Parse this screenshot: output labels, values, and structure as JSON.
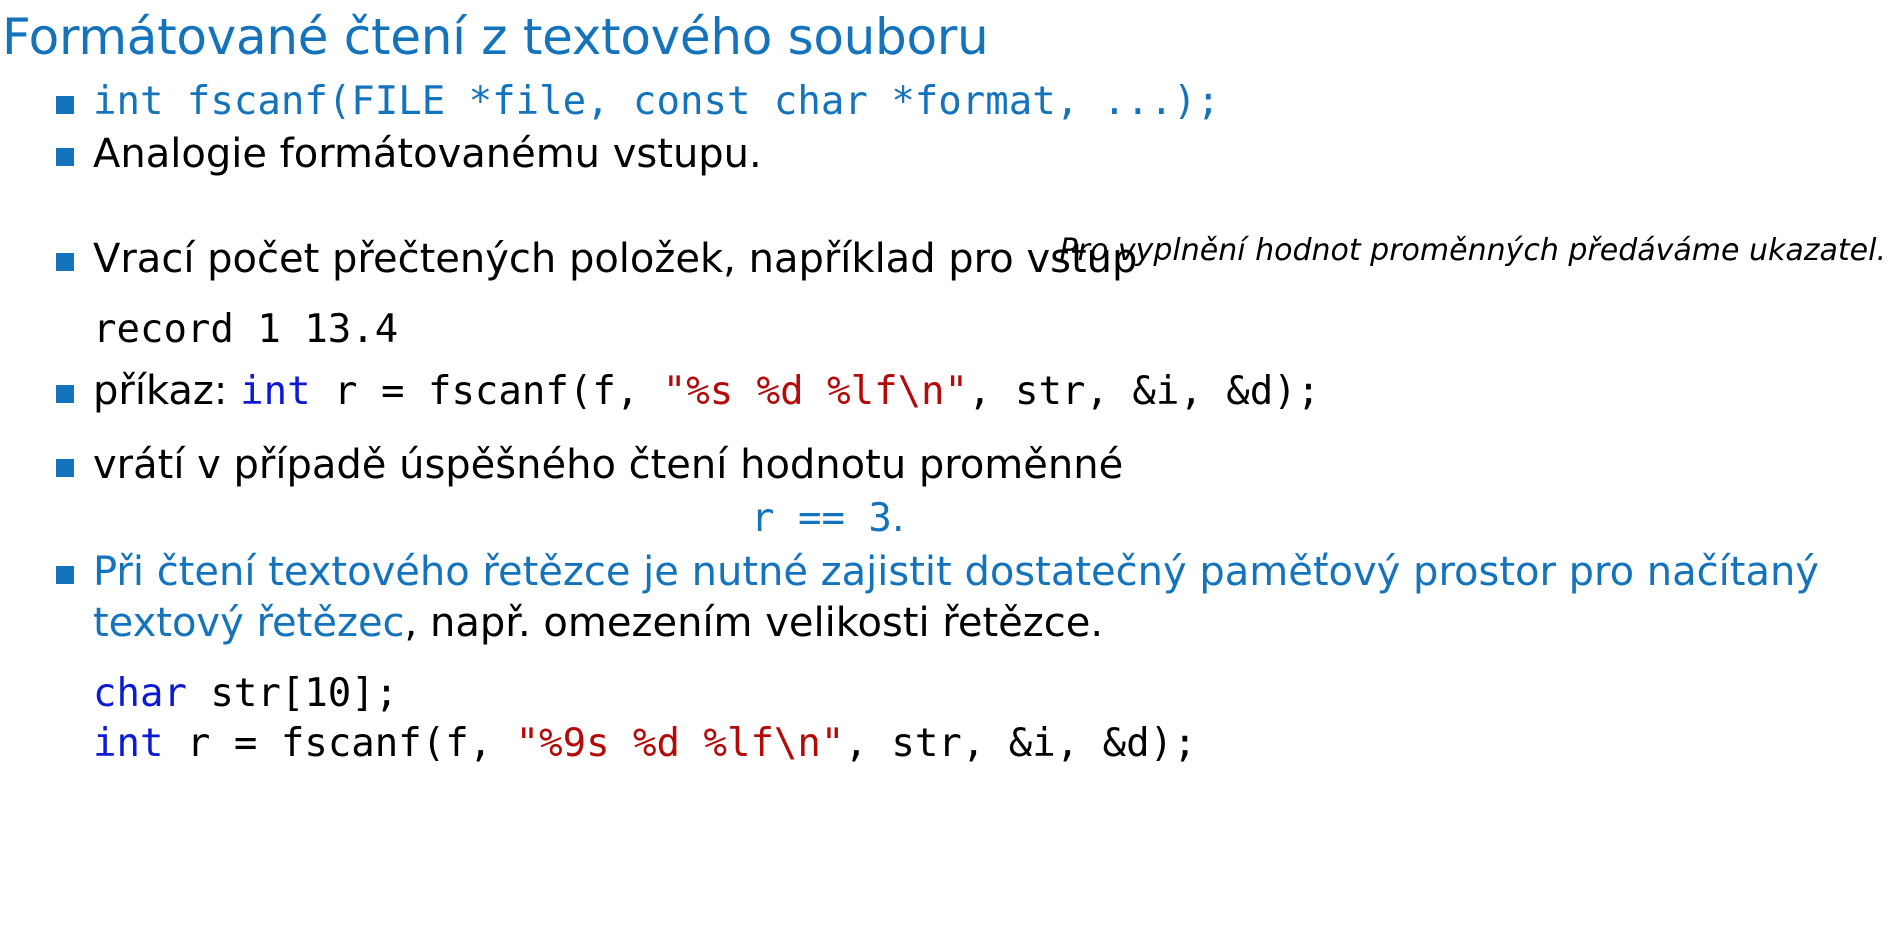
{
  "title": "Formátované čtení z textového souboru",
  "colors": {
    "title": "#1473bd",
    "accent": "#1473bd",
    "keyword": "#0a1ad6",
    "string_literal": "#b40a0a",
    "text": "#000000"
  },
  "bullets": {
    "signature": "int fscanf(FILE *file, const char *format, ...);",
    "analogy": "Analogie formátovanému vstupu.",
    "note": "Pro vyplnění hodnot proměnných předáváme ukazatel.",
    "returns": "Vrací počet přečtených položek, například pro vstup",
    "input_example": "record 1 13.4",
    "command": {
      "label": "příkaz: ",
      "kw": "int",
      "code_a": " r = fscanf(f, ",
      "str": "\"%s %d %lf\\n\"",
      "code_b": ", str, &i, &d);"
    },
    "result_text": "vrátí v případě úspěšného čtení hodnotu proměnné",
    "result_code": "r == 3",
    "result_dot": ".",
    "warning": {
      "line1_blue": "Při čtení textového řetězce je nutné zajistit dostatečný paměťový prostor pro načítaný",
      "line2_blue": "textový řetězec",
      "line2_rest": ", např. omezením velikosti řetězce."
    },
    "code_example": {
      "line1_kw": "char",
      "line1_rest": " str[10];",
      "line2_kw": "int",
      "line2_a": " r = fscanf(f, ",
      "line2_str": "\"%9s %d %lf\\n\"",
      "line2_b": ", str, &i, &d);"
    }
  }
}
